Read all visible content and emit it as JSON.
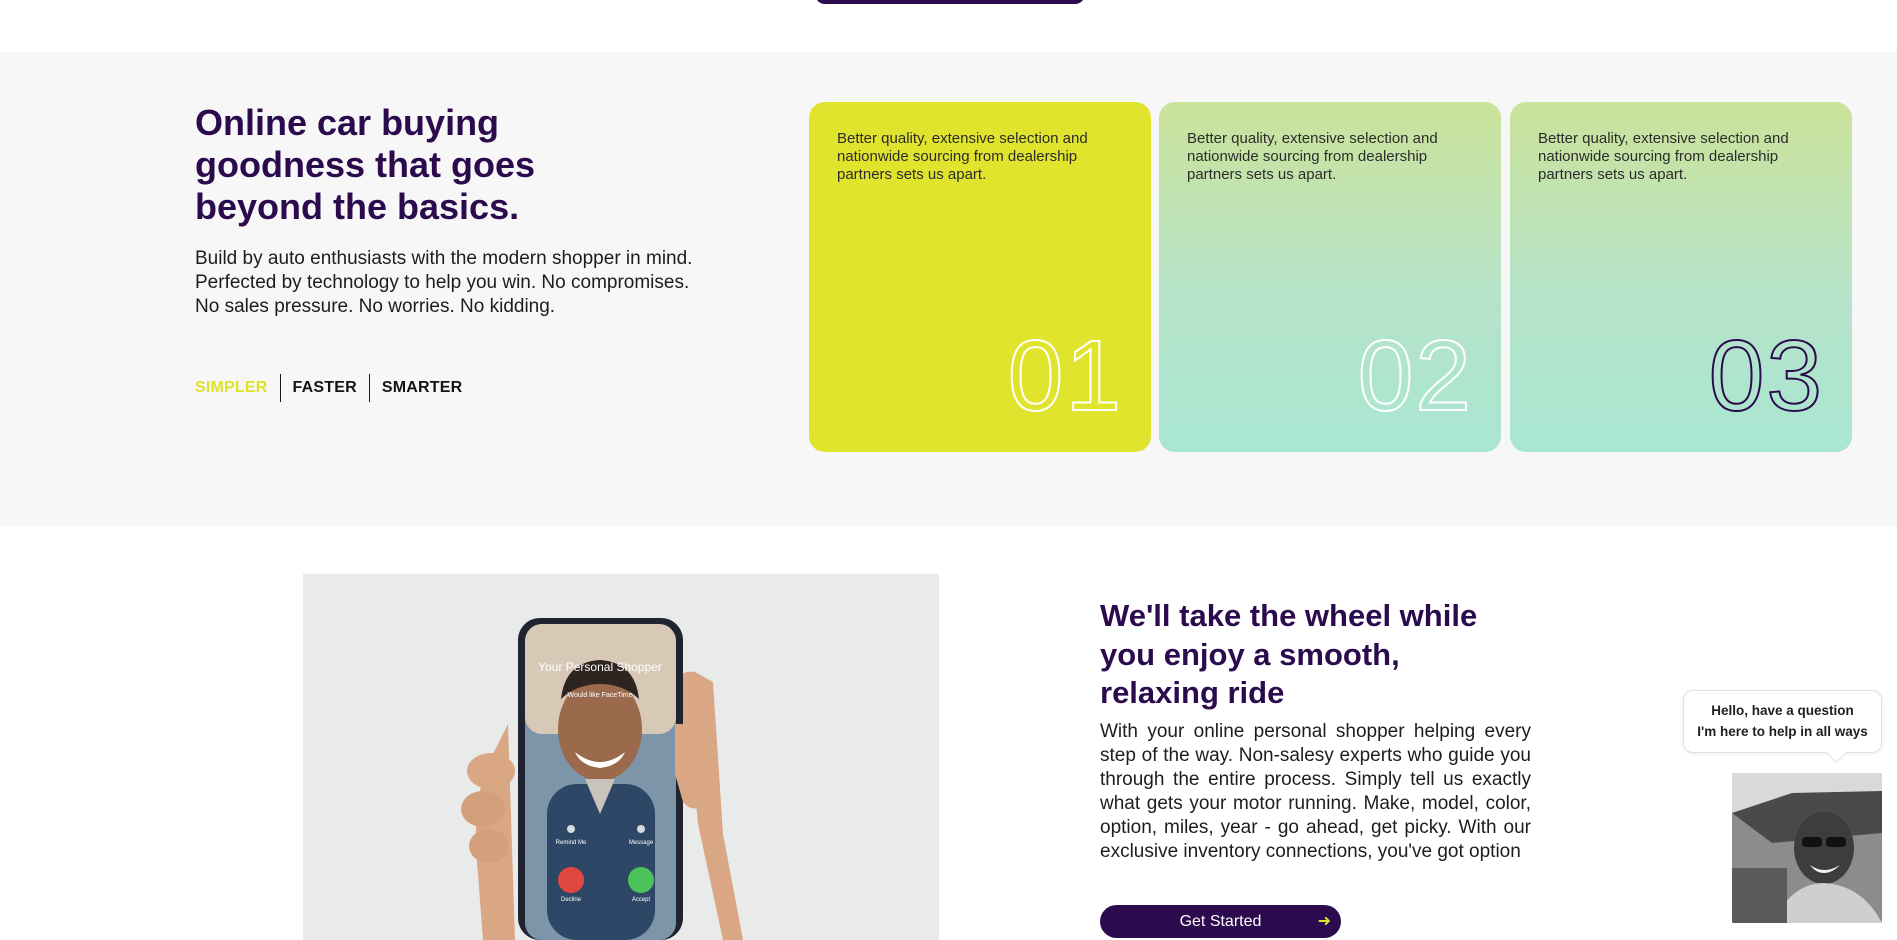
{
  "benefits": {
    "title": "Online car buying goodness that goes beyond the basics.",
    "text": "Build by auto enthusiasts with the modern shopper in mind. Perfected by technology to help you win. No compromises. No sales pressure. No worries. No kidding.",
    "tabs": [
      {
        "label": "SIMPLER",
        "active": true
      },
      {
        "label": "FASTER",
        "active": false
      },
      {
        "label": "SMARTER",
        "active": false
      }
    ],
    "cards": [
      {
        "text": "Better quality, extensive selection and nationwide sourcing from dealership partners sets us apart.",
        "number": "01"
      },
      {
        "text": "Better quality, extensive selection and nationwide sourcing from dealership partners sets us apart.",
        "number": "02"
      },
      {
        "text": "Better quality, extensive selection and nationwide sourcing from dealership partners sets us apart.",
        "number": "03"
      }
    ]
  },
  "phone": {
    "caller": "Your Personal Shopper",
    "subtitle": "Would like FaceTime",
    "remind_label": "Remind Me",
    "message_label": "Message",
    "decline_label": "Decline",
    "accept_label": "Accept"
  },
  "ride": {
    "title": "We'll take the wheel while you enjoy a smooth, relaxing ride",
    "text": "With your online personal shopper helping every step of the way. Non-salesy experts who guide you through the entire process. Simply tell us exactly what gets your motor running. Make, model, color, option, miles, year - go ahead, get picky. With our exclusive inventory connections, you've got option",
    "cta_label": "Get Started",
    "cta_icon": "arrow-right-icon"
  },
  "chat": {
    "line1": "Hello, have a question",
    "line2": "I'm here to help in all ways"
  },
  "colors": {
    "brand_purple": "#2b0a4d",
    "accent_yellow": "#e1e42c",
    "mint": "#a9e6d2"
  }
}
